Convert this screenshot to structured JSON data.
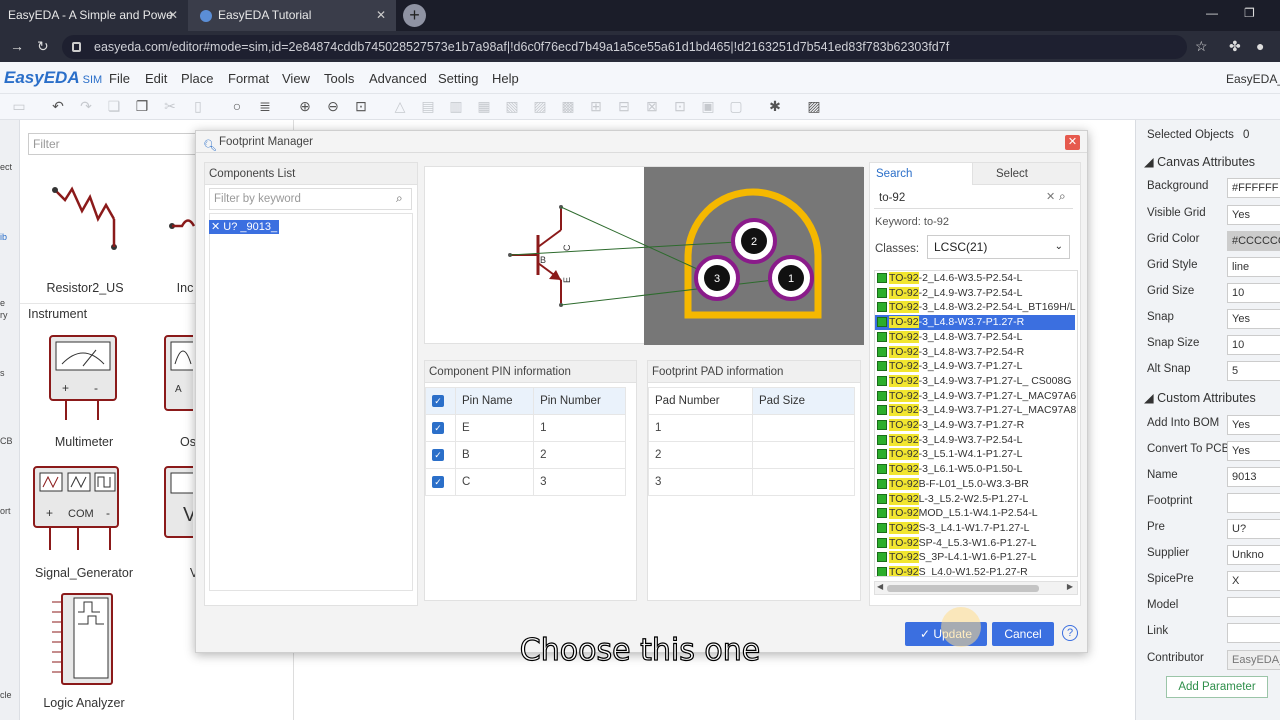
{
  "browser": {
    "tabs": [
      {
        "label": "EasyEDA - A Simple and Powe"
      },
      {
        "label": "EasyEDA Tutorial"
      }
    ],
    "url": "easyeda.com/editor#mode=sim,id=2e84874cddb745028527573e1b7a98af|!d6c0f76ecd7b49a1a5ce55a61d1bd465|!d2163251d7b541ed83f783b62303fd7f"
  },
  "app": {
    "logo": "EasyEDA",
    "logo_suffix": "SIM",
    "menus": [
      "File",
      "Edit",
      "Place",
      "Format",
      "View",
      "Tools",
      "Advanced",
      "Setting",
      "Help"
    ],
    "user": "EasyEDA_N"
  },
  "library": {
    "filter_placeholder": "Filter",
    "section": "Instrument",
    "items": [
      "Resistor2_US",
      "Inc",
      "Multimeter",
      "Os",
      "Signal_Generator",
      "V",
      "Logic Analyzer"
    ],
    "rail": [
      "ect",
      "ib",
      "e",
      "ry",
      "s",
      "CB",
      "ort",
      "cle"
    ]
  },
  "dialog": {
    "title": "Footprint Manager",
    "components": {
      "header": "Components List",
      "filter_placeholder": "Filter by keyword",
      "selected": "U? _9013_"
    },
    "preview": {
      "schematic_labels": [
        "B",
        "E",
        "C"
      ],
      "pad_labels": [
        "2",
        "3",
        "1"
      ]
    },
    "pin_info": {
      "header": "Component PIN information",
      "columns": [
        "Pin Name",
        "Pin Number"
      ],
      "rows": [
        {
          "name": "E",
          "number": "1"
        },
        {
          "name": "B",
          "number": "2"
        },
        {
          "name": "C",
          "number": "3"
        }
      ]
    },
    "pad_info": {
      "header": "Footprint PAD information",
      "columns": [
        "Pad Number",
        "Pad Size"
      ],
      "rows": [
        "1",
        "2",
        "3"
      ]
    },
    "search": {
      "tabs": [
        "Search",
        "Select"
      ],
      "query": "to-92",
      "keyword_text": "Keyword: to-92",
      "classes_label": "Classes:",
      "classes_value": "LCSC(21)",
      "highlight": "TO-92",
      "results": [
        {
          "hl": "TO-92",
          "rest": "-2_L4.6-W3.5-P2.54-L"
        },
        {
          "hl": "TO-92",
          "rest": "-2_L4.9-W3.7-P2.54-L"
        },
        {
          "hl": "TO-92",
          "rest": "-3_L4.8-W3.2-P2.54-L_BT169H/L"
        },
        {
          "hl": "TO-92",
          "rest": "-3_L4.8-W3.7-P1.27-R"
        },
        {
          "hl": "TO-92",
          "rest": "-3_L4.8-W3.7-P2.54-L"
        },
        {
          "hl": "TO-92",
          "rest": "-3_L4.8-W3.7-P2.54-R"
        },
        {
          "hl": "TO-92",
          "rest": "-3_L4.9-W3.7-P1.27-L"
        },
        {
          "hl": "TO-92",
          "rest": "-3_L4.9-W3.7-P1.27-L_ CS008G"
        },
        {
          "hl": "TO-92",
          "rest": "-3_L4.9-W3.7-P1.27-L_MAC97A6"
        },
        {
          "hl": "TO-92",
          "rest": "-3_L4.9-W3.7-P1.27-L_MAC97A8"
        },
        {
          "hl": "TO-92",
          "rest": "-3_L4.9-W3.7-P1.27-R"
        },
        {
          "hl": "TO-92",
          "rest": "-3_L4.9-W3.7-P2.54-L"
        },
        {
          "hl": "TO-92",
          "rest": "-3_L5.1-W4.1-P1.27-L"
        },
        {
          "hl": "TO-92",
          "rest": "-3_L6.1-W5.0-P1.50-L"
        },
        {
          "hl": "TO-92",
          "rest": "B-F-L01_L5.0-W3.3-BR"
        },
        {
          "hl": "TO-92",
          "rest": "L-3_L5.2-W2.5-P1.27-L"
        },
        {
          "hl": "TO-92",
          "rest": "MOD_L5.1-W4.1-P2.54-L"
        },
        {
          "hl": "TO-92",
          "rest": "S-3_L4.1-W1.7-P1.27-L"
        },
        {
          "hl": "TO-92",
          "rest": "SP-4_L5.3-W1.6-P1.27-L"
        },
        {
          "hl": "TO-92",
          "rest": "S_3P-L4.1-W1.6-P1.27-L"
        },
        {
          "hl": "TO-92",
          "rest": "S_L4.0-W1.52-P1.27-R"
        }
      ],
      "selected_index": 3
    },
    "buttons": {
      "update": "Update",
      "cancel": "Cancel",
      "help": "?"
    }
  },
  "props": {
    "selected_objects_label": "Selected Objects",
    "selected_objects_count": "0",
    "canvas_section": "Canvas Attributes",
    "canvas": [
      {
        "label": "Background",
        "value": "#FFFFFF"
      },
      {
        "label": "Visible Grid",
        "value": "Yes"
      },
      {
        "label": "Grid Color",
        "value": "#CCCCCC"
      },
      {
        "label": "Grid Style",
        "value": "line"
      },
      {
        "label": "Grid Size",
        "value": "10"
      },
      {
        "label": "Snap",
        "value": "Yes"
      },
      {
        "label": "Snap Size",
        "value": "10"
      },
      {
        "label": "Alt Snap",
        "value": "5"
      }
    ],
    "custom_section": "Custom Attributes",
    "custom": [
      {
        "label": "Add Into BOM",
        "value": "Yes"
      },
      {
        "label": "Convert To PCB",
        "value": "Yes"
      },
      {
        "label": "Name",
        "value": "9013"
      },
      {
        "label": "Footprint",
        "value": ""
      },
      {
        "label": "Pre",
        "value": "U?"
      },
      {
        "label": "Supplier",
        "value": "Unkno"
      },
      {
        "label": "SpicePre",
        "value": "X"
      },
      {
        "label": "Model",
        "value": ""
      },
      {
        "label": "Link",
        "value": ""
      },
      {
        "label": "Contributor",
        "value": "EasyEDA_"
      }
    ],
    "add_param": "Add Parameter"
  },
  "caption": "Choose this one",
  "colors": {
    "accent": "#3b6fe0",
    "pad_ring": "#f5b800",
    "pad_purple": "#8a1b8a",
    "schematic": "#8b1a1a"
  }
}
